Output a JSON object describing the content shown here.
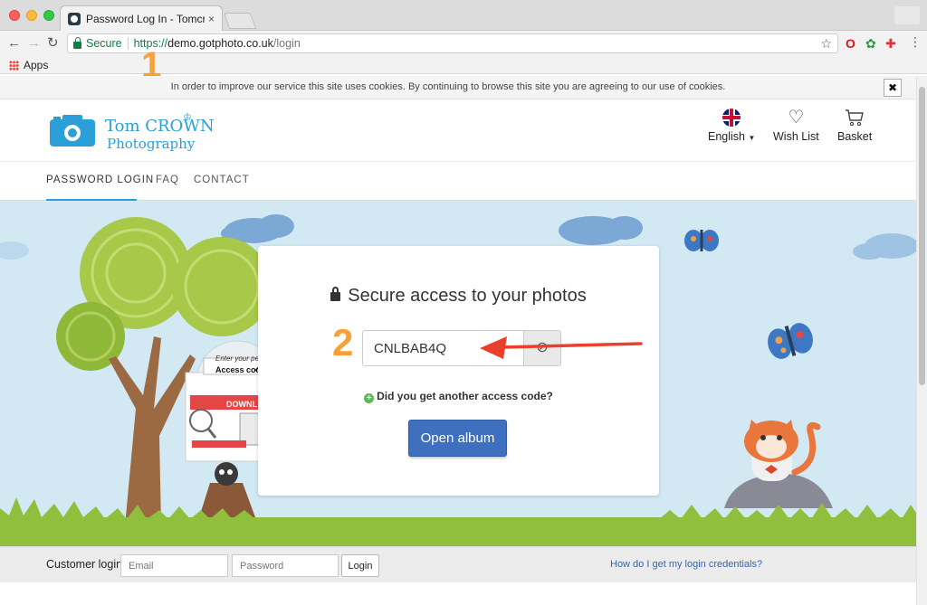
{
  "browser": {
    "tab_title": "Password Log In - Tomcrown P",
    "tab_close": "×",
    "secure_label": "Secure",
    "url_protocol": "https://",
    "url_host": "demo.gotphoto.co.uk",
    "url_path": "/login",
    "bookmark_apps": "Apps"
  },
  "annotations": {
    "step1": "1",
    "step2": "2"
  },
  "cookie": {
    "text": "In order to improve our service this site uses cookies. By continuing to browse this site you are agreeing to our use of cookies.",
    "close": "✖"
  },
  "header": {
    "logo_line1": "Tom CROWN",
    "logo_line2": "Photography",
    "language": "English",
    "wishlist": "Wish List",
    "basket": "Basket"
  },
  "nav": {
    "items": [
      "PASSWORD LOGIN",
      "FAQ",
      "CONTACT"
    ]
  },
  "login": {
    "heading": "Secure access to your photos",
    "access_code": "CNLBAB4Q",
    "another_code": "Did you get another access code?",
    "open_album": "Open album"
  },
  "illustration": {
    "enter_text": "Enter your perso",
    "access_code_label": "Access code",
    "download_label": "DOWNL"
  },
  "footer": {
    "customer_login": "Customer login",
    "email_placeholder": "Email",
    "password_placeholder": "Password",
    "login_button": "Login",
    "credentials_link": "How do I get my login credentials?"
  },
  "colors": {
    "brand_blue": "#2a9fd8",
    "button_blue": "#3f6fbf",
    "annotation_orange": "#f5a13a",
    "arrow_red": "#e8402b",
    "sky": "#d2e9f4",
    "grass": "#8fbf3c"
  },
  "icons": [
    "lock-icon",
    "star-icon",
    "flag-uk-icon",
    "heart-icon",
    "cart-icon",
    "visibility-icon",
    "plus-circle-icon",
    "camera-logo-icon"
  ]
}
